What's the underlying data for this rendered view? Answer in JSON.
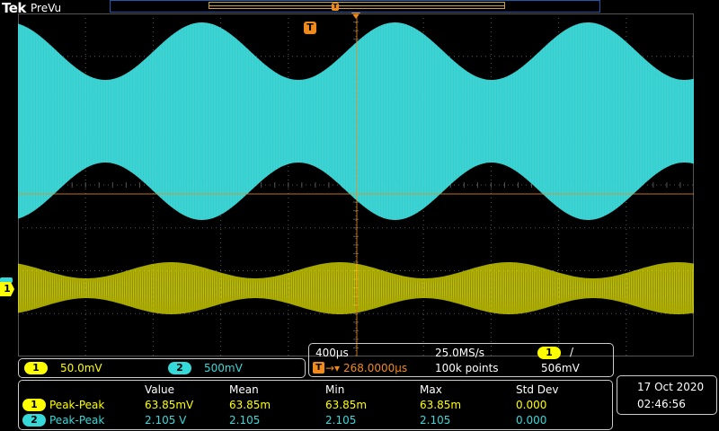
{
  "header": {
    "brand": "Tek",
    "mode": "PreVu"
  },
  "trigger_marker": "T",
  "channels": [
    {
      "id": "1",
      "scale": "50.0mV",
      "color": "#ffff00"
    },
    {
      "id": "2",
      "scale": "500mV",
      "color": "#36d9d9"
    }
  ],
  "timebase": {
    "time_div": "400µs",
    "sample_rate": "25.0MS/s",
    "trigger_source": "1",
    "trigger_slope": "/",
    "trigger_delay": "268.0000µs",
    "record_length": "100k points",
    "trigger_level": "506mV"
  },
  "measurements": {
    "headers": [
      "Value",
      "Mean",
      "Min",
      "Max",
      "Std Dev"
    ],
    "rows": [
      {
        "channel": "1",
        "name": "Peak-Peak",
        "values": [
          "63.85mV",
          "63.85m",
          "63.85m",
          "63.85m",
          "0.000"
        ]
      },
      {
        "channel": "2",
        "name": "Peak-Peak",
        "values": [
          "2.105 V",
          "2.105",
          "2.105",
          "2.105",
          "0.000"
        ]
      }
    ]
  },
  "datetime": {
    "date": "17 Oct  2020",
    "time": "02:46:56"
  },
  "colors": {
    "ch1": "#ffff00",
    "ch2": "#36d9d9",
    "trigger": "#f08a1c",
    "grid": "#555555"
  }
}
